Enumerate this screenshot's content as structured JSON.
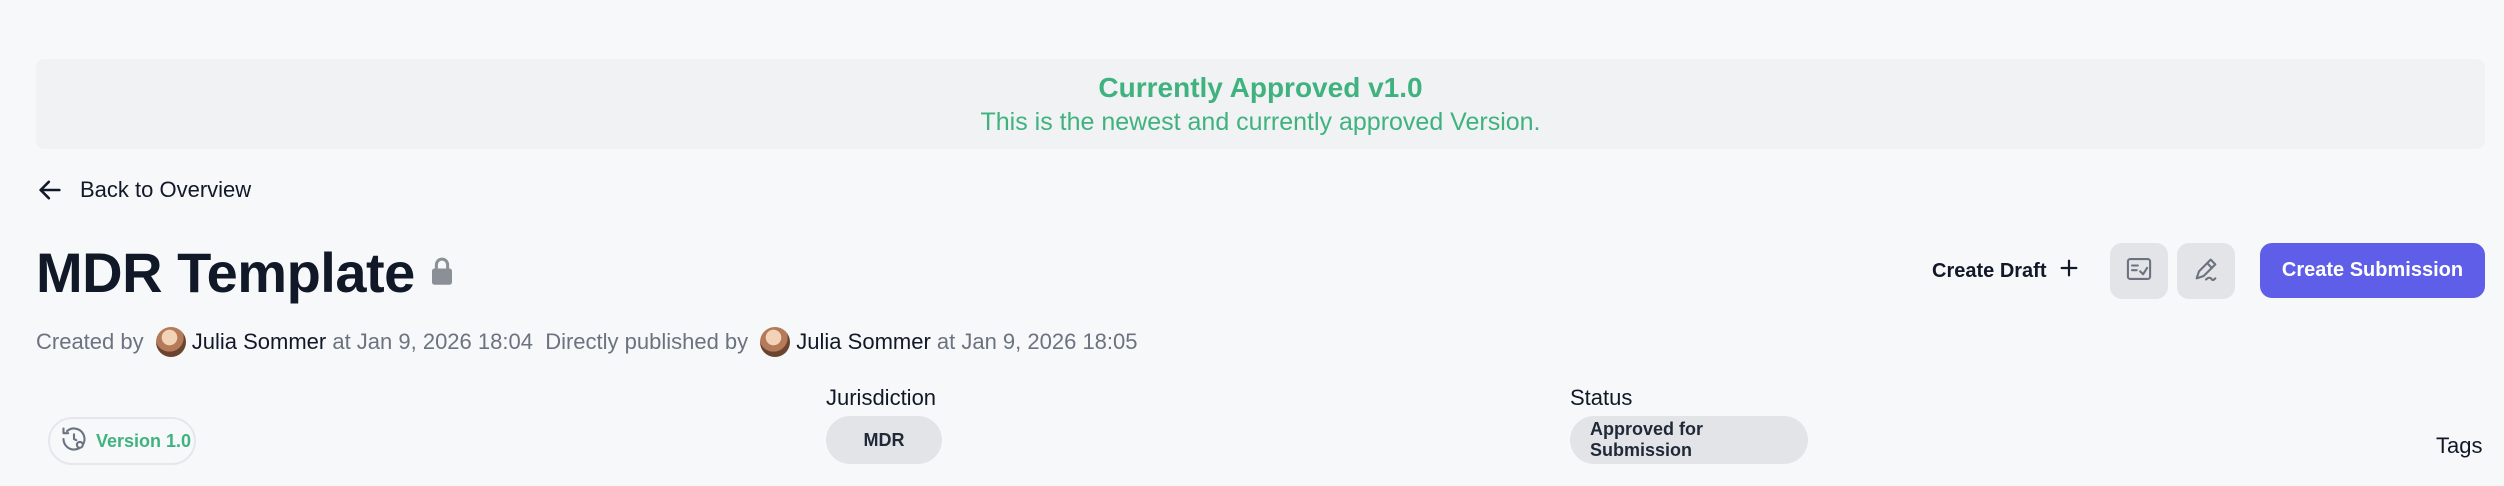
{
  "banner": {
    "title": "Currently Approved v1.0",
    "subtitle": "This is the newest and currently approved Version."
  },
  "back": {
    "label": "Back to Overview"
  },
  "page": {
    "title": "MDR Template"
  },
  "meta": {
    "created_prefix": "Created by ",
    "creator": "Julia Sommer",
    "created_at": " at Jan 9, 2026 18:04",
    "published_prefix": "Directly published by ",
    "publisher": "Julia Sommer",
    "published_at": " at Jan 9, 2026 18:05"
  },
  "actions": {
    "create_draft": "Create Draft",
    "create_submission": "Create Submission"
  },
  "version": {
    "label": "Version 1.0"
  },
  "jurisdiction": {
    "label": "Jurisdiction",
    "value": "MDR"
  },
  "status": {
    "label": "Status",
    "value": "Approved for Submission"
  },
  "tags": {
    "label": "Tags"
  },
  "colors": {
    "accent": "#3fb27f",
    "primary_button": "#5f5ee8"
  },
  "icons": [
    "arrow-left-icon",
    "lock-icon",
    "plus-icon",
    "checklist-icon",
    "sign-icon",
    "history-settings-icon"
  ]
}
